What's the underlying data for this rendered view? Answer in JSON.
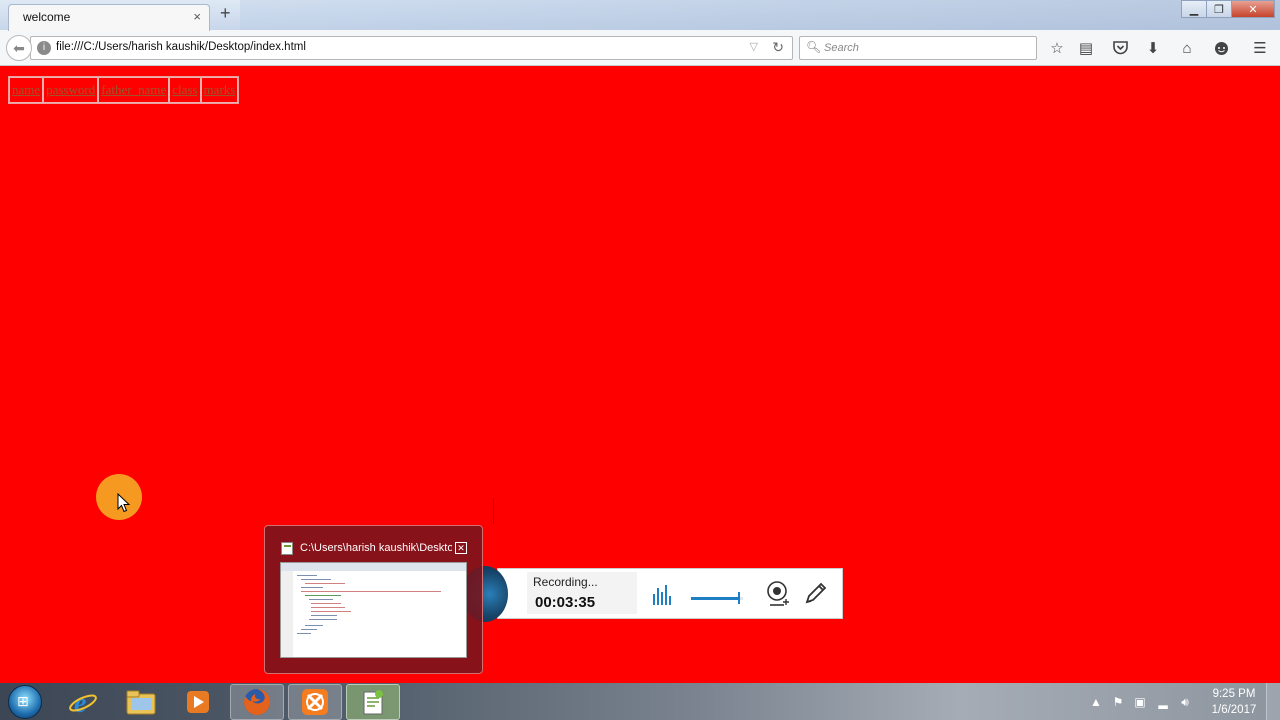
{
  "browser": {
    "tab_title": "welcome",
    "tab_close": "×",
    "new_tab": "+",
    "url": "file:///C:/Users/harish kaushik/Desktop/index.html",
    "search_placeholder": "Search"
  },
  "page": {
    "table_headers": [
      "name",
      "password",
      "father_name",
      "class",
      "marks"
    ],
    "background_color": "#ff0000"
  },
  "preview": {
    "title": "C:\\Users\\harish kaushik\\Desktop"
  },
  "recorder": {
    "status": "Recording...",
    "elapsed": "00:03:35",
    "volume_level": 0.9
  },
  "taskbar": {
    "time": "9:25 PM",
    "date": "1/6/2017"
  },
  "icons": {
    "back": "back-arrow-icon",
    "reload": "reload-icon",
    "search": "search-icon",
    "bookmark": "star-icon",
    "reading_list": "clipboard-icon",
    "pocket": "pocket-icon",
    "downloads": "download-icon",
    "home": "home-icon",
    "chat": "chat-icon",
    "menu": "hamburger-menu-icon"
  }
}
